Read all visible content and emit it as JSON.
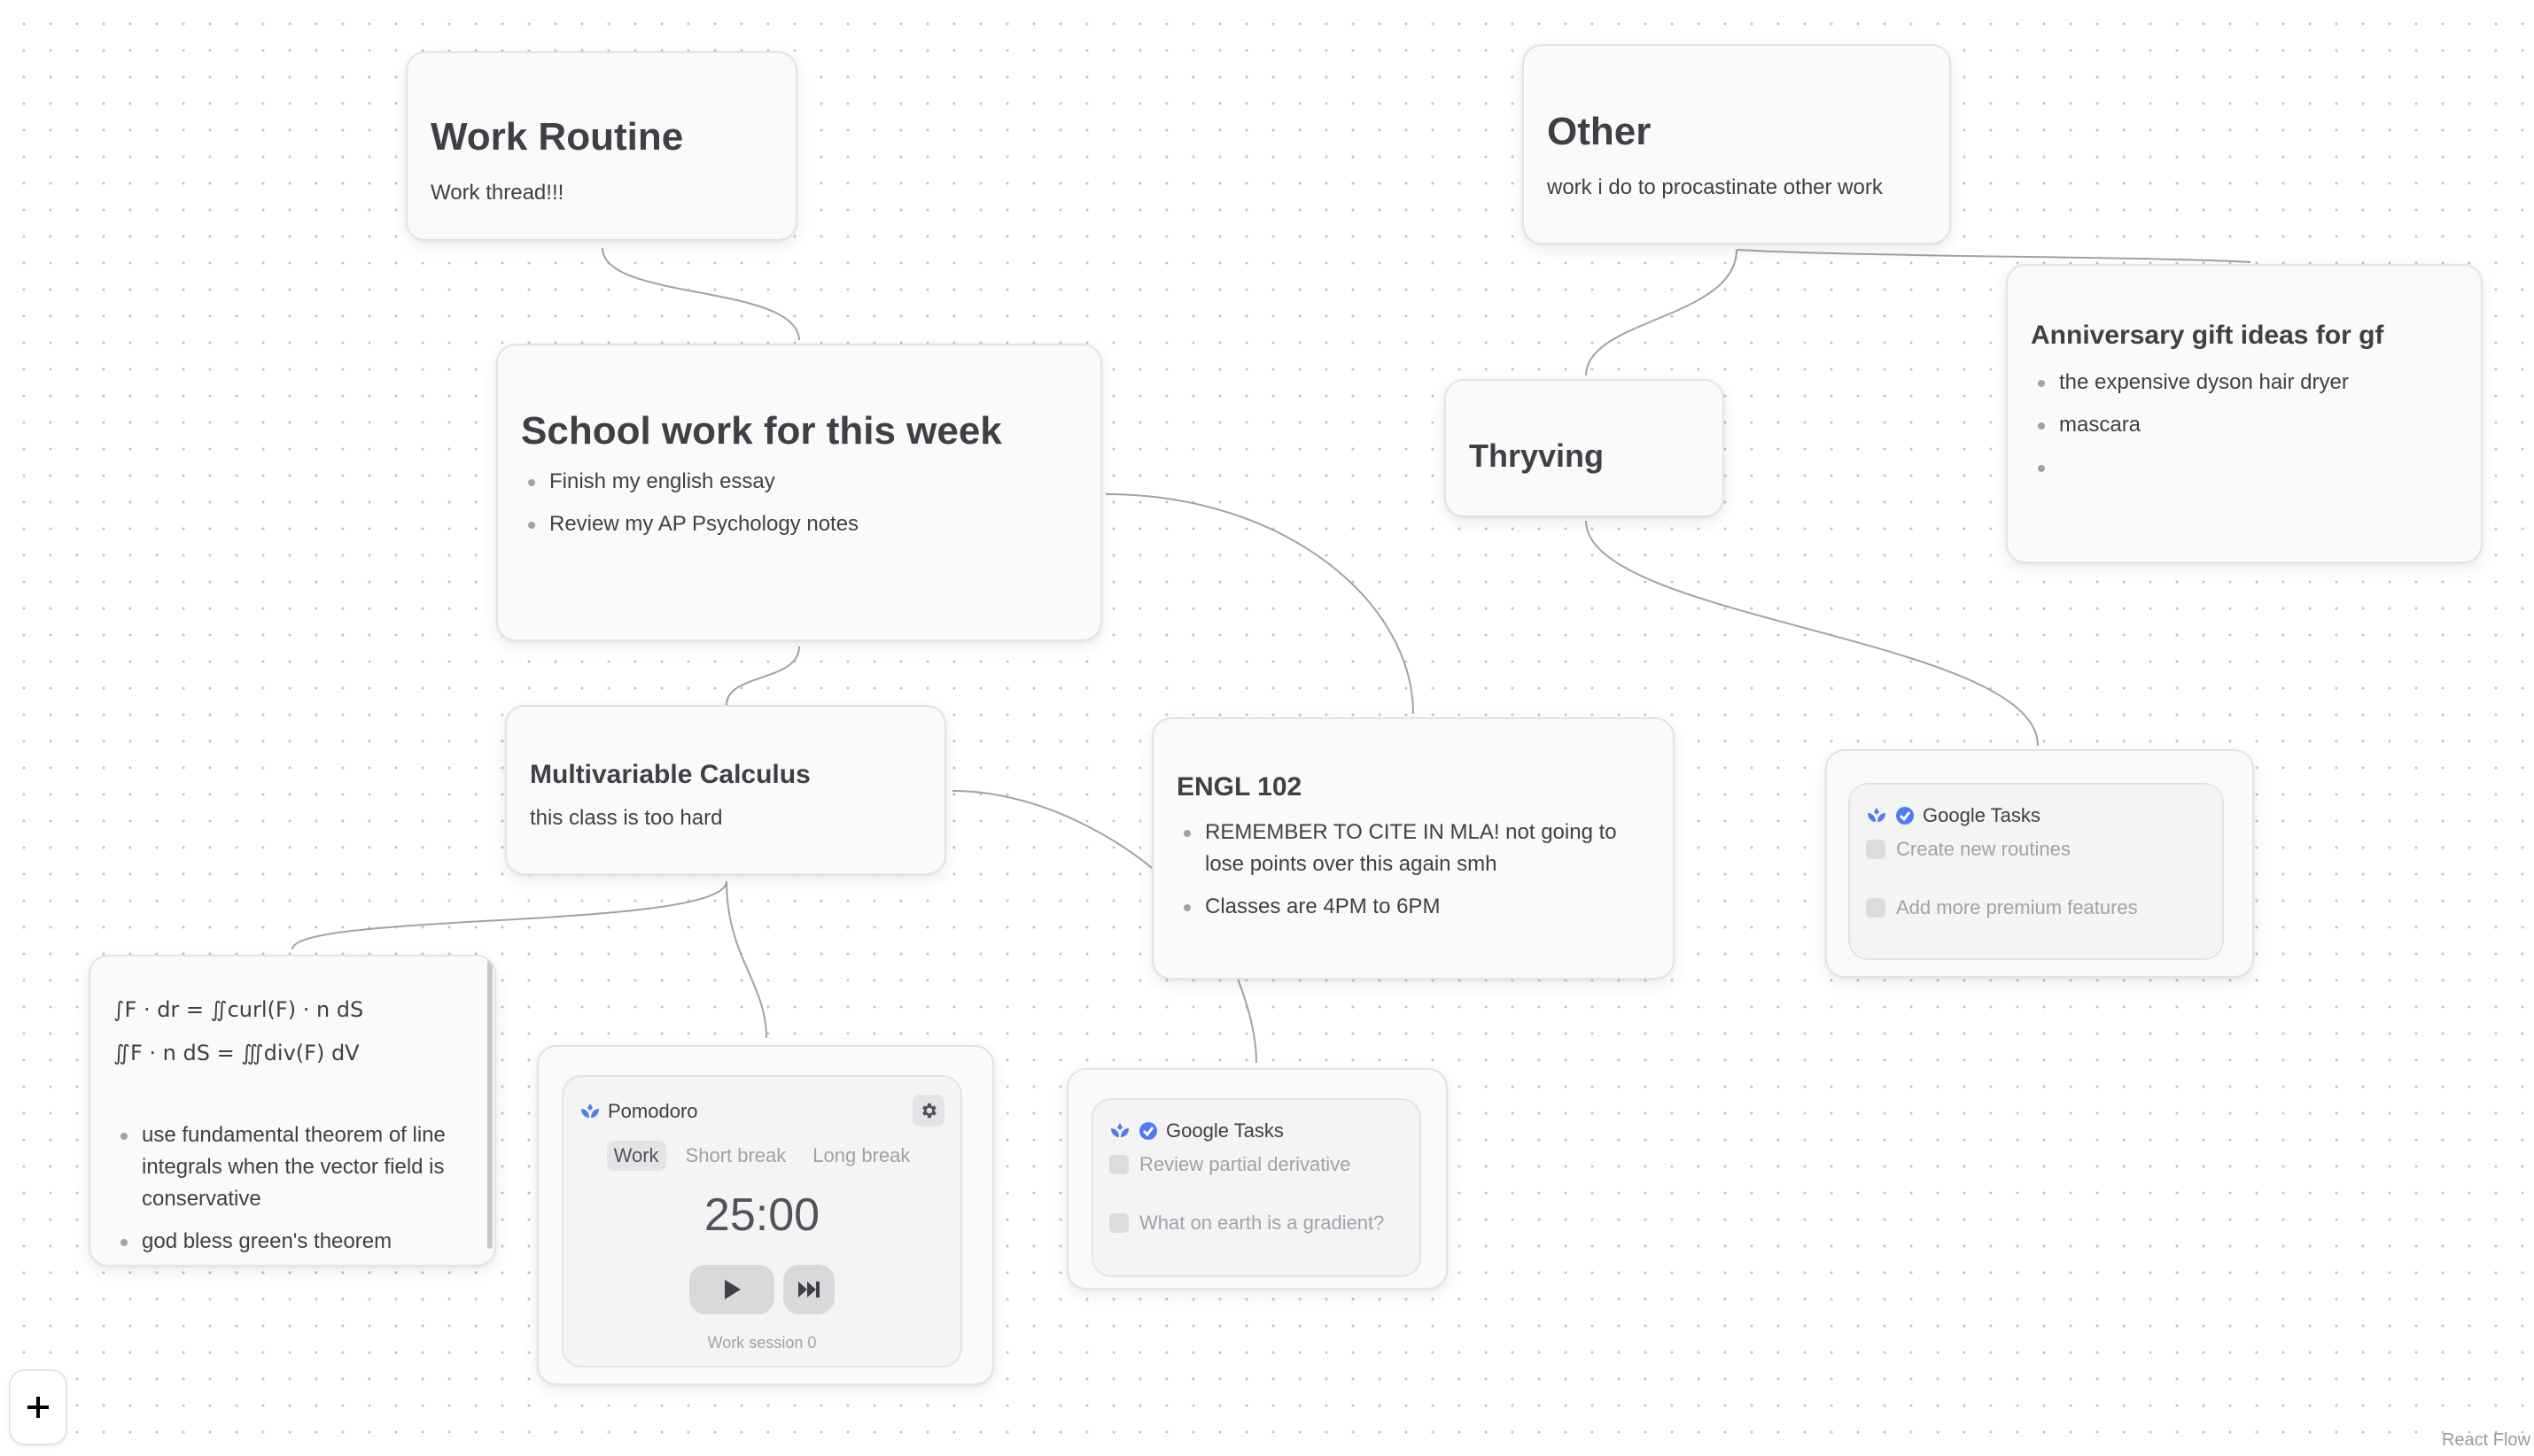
{
  "canvas": {
    "attribution": "React Flow",
    "add_button_icon": "plus-icon",
    "edge_color": "#a1a1aa",
    "accent_color": "#4f7df0"
  },
  "nodes": {
    "work_routine": {
      "title": "Work Routine",
      "description": "Work thread!!!"
    },
    "other": {
      "title": "Other",
      "description": "work i do to procastinate other work"
    },
    "anniversary": {
      "title": "Anniversary gift ideas for gf",
      "items": [
        "the expensive dyson hair dryer",
        "mascara",
        ""
      ]
    },
    "thryving": {
      "title": "Thryving"
    },
    "school": {
      "title": "School work for this week",
      "items": [
        "Finish my english essay",
        "Review my AP Psychology notes"
      ]
    },
    "calculus": {
      "title": "Multivariable Calculus",
      "description": "this class is too hard"
    },
    "engl": {
      "title": "ENGL 102",
      "items": [
        "REMEMBER TO CITE IN MLA! not going to lose points over this again smh",
        "Classes are 4PM to 6PM"
      ]
    },
    "calc_notes": {
      "lines": [
        "∫F · dr = ∬curl(F) · n dS",
        "∬F · n dS = ∭div(F) dV"
      ],
      "items": [
        "use fundamental theorem of line integrals when the vector field is conservative",
        "god bless green's theorem"
      ]
    },
    "pomodoro": {
      "title": "Pomodoro",
      "tabs": [
        "Work",
        "Short break",
        "Long break"
      ],
      "active_tab": "Work",
      "time": "25:00",
      "session_label": "Work session 0",
      "settings_icon": "gear-icon",
      "play_icon": "play-icon",
      "skip_icon": "skip-forward-icon"
    },
    "tasks_calc": {
      "title": "Google Tasks",
      "tasks": [
        {
          "label": "Review partial derivative",
          "checked": false
        },
        {
          "label": "What on earth is a gradient?",
          "checked": false
        }
      ]
    },
    "tasks_thryving": {
      "title": "Google Tasks",
      "tasks": [
        {
          "label": "Create new routines",
          "checked": false
        },
        {
          "label": "Add more premium features",
          "checked": false
        }
      ]
    }
  }
}
